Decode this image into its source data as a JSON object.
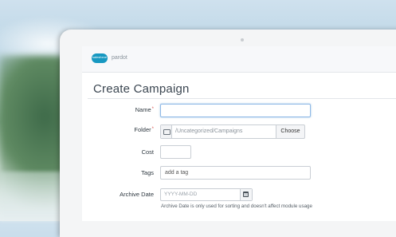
{
  "brand": {
    "logo_text": "salesforce",
    "app_name": "pardot"
  },
  "form": {
    "title": "Create Campaign",
    "name": {
      "label": "Name",
      "required_mark": "*",
      "value": ""
    },
    "folder": {
      "label": "Folder",
      "required_mark": "*",
      "path": "/Uncategorized/Campaigns",
      "choose_label": "Choose"
    },
    "cost": {
      "label": "Cost",
      "value": ""
    },
    "tags": {
      "label": "Tags",
      "placeholder": "add a tag"
    },
    "archive_date": {
      "label": "Archive Date",
      "placeholder": "YYYY-MM-DD",
      "help": "Archive Date is only used for sorting and doesn't affect module usage"
    }
  },
  "icons": {
    "folder": "folder-icon",
    "calendar": "calendar-icon"
  },
  "colors": {
    "required": "#d9534f",
    "focus": "#8fb9e6",
    "brand": "#1798c1"
  }
}
